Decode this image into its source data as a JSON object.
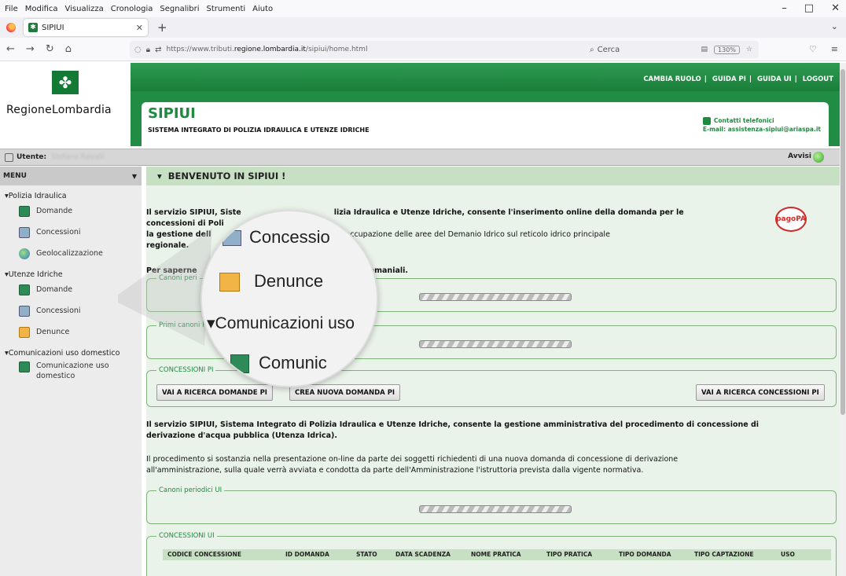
{
  "browser": {
    "menu": [
      "File",
      "Modifica",
      "Visualizza",
      "Cronologia",
      "Segnalibri",
      "Strumenti",
      "Aiuto"
    ],
    "tab_title": "SIPIUI",
    "url_prefix": "https://www.tributi.",
    "url_domain": "regione.lombardia.it",
    "url_path": "/sipiui/home.html",
    "zoom": "130%",
    "search_placeholder": "Cerca"
  },
  "header": {
    "logo_text": "RegioneLombardia",
    "top_links": [
      "CAMBIA RUOLO",
      "GUIDA PI",
      "GUIDA UI",
      "LOGOUT"
    ],
    "app_title": "SIPIUI",
    "app_subtitle": "SISTEMA INTEGRATO DI POLIZIA IDRAULICA E UTENZE IDRICHE",
    "contact_title": "Contatti telefonici",
    "contact_email": "E-mail: assistenza-sipiui@ariaspa.it"
  },
  "userbar": {
    "label": "Utente:",
    "name": "Stefano Ravalli",
    "avvisi": "Avvisi"
  },
  "sidebar": {
    "menu_label": "MENU",
    "groups": [
      {
        "label": "Polizia Idraulica",
        "items": [
          "Domande",
          "Concessioni",
          "Geolocalizzazione"
        ]
      },
      {
        "label": "Utenze Idriche",
        "items": [
          "Domande",
          "Concessioni",
          "Denunce"
        ]
      },
      {
        "label": "Comunicazioni uso domestico",
        "items": [
          "Comunicazione uso domestico"
        ]
      }
    ]
  },
  "main": {
    "welcome": "BENVENUTO IN SIPIUI !",
    "intro_line1_a": "Il servizio SIPIUI, Siste",
    "intro_line1_b": "lizia Idraulica e Utenze Idriche, consente l'inserimento online della domanda per le",
    "intro_line2": "concessioni di Poli",
    "intro_line3_a": "la gestione dell",
    "intro_line3_b": "ne per l'occupazione delle aree del Demanio Idrico sul reticolo idrico principale",
    "intro_line4": "regionale.",
    "saperne_a": "Per saperne",
    "saperne_b": "ezione Canoni demaniali.",
    "pagopa": "pagoPA",
    "box_canoni_pi": "Canoni peri",
    "box_primi_canoni": "Primi canoni PI",
    "box_concessioni_pi": "CONCESSIONI PI",
    "btn_ricerca_domande": "VAI A RICERCA DOMANDE PI",
    "btn_crea_domanda": "CREA NUOVA DOMANDA PI",
    "btn_ricerca_concessioni": "VAI A RICERCA CONCESSIONI PI",
    "ui_par1_line1": "Il servizio SIPIUI, Sistema Integrato di Polizia Idraulica e Utenze Idriche, consente la gestione amministrativa del procedimento di concessione di",
    "ui_par1_line2": "derivazione d'acqua pubblica (Utenza Idrica).",
    "ui_par2_line1": "Il procedimento si sostanzia nella presentazione on-line da parte dei soggetti richiedenti di una nuova domanda di concessione di derivazione",
    "ui_par2_line2": "all'amministrazione, sulla quale verrà avviata e condotta da parte dell'Amministrazione l'istruttoria prevista dalla vigente normativa.",
    "box_canoni_ui": "Canoni periodici UI",
    "box_concessioni_ui": "CONCESSIONI UI",
    "table_columns": [
      "CODICE CONCESSIONE",
      "ID DOMANDA",
      "STATO",
      "DATA SCADENZA",
      "NOME PRATICA",
      "TIPO PRATICA",
      "TIPO DOMANDA",
      "TIPO CAPTAZIONE",
      "USO"
    ]
  },
  "magnifier": {
    "row1": "Concessio",
    "row2": "Denunce",
    "row3": "Comunicazioni uso",
    "row4": "Comunic"
  }
}
